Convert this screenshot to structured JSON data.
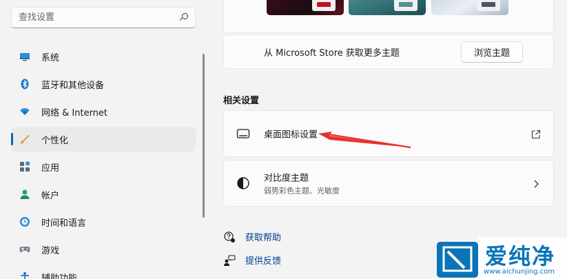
{
  "sidebar": {
    "search": {
      "placeholder": "查找设置"
    },
    "items": [
      {
        "label": "系统",
        "icon": "monitor-icon"
      },
      {
        "label": "蓝牙和其他设备",
        "icon": "bluetooth-icon"
      },
      {
        "label": "网络 & Internet",
        "icon": "wifi-icon"
      },
      {
        "label": "个性化",
        "icon": "brush-icon",
        "active": true
      },
      {
        "label": "应用",
        "icon": "apps-icon"
      },
      {
        "label": "帐户",
        "icon": "person-icon"
      },
      {
        "label": "时间和语言",
        "icon": "globe-clock-icon"
      },
      {
        "label": "游戏",
        "icon": "gamepad-icon"
      },
      {
        "label": "辅助功能",
        "icon": "accessibility-icon"
      }
    ]
  },
  "main": {
    "store": {
      "text": "从 Microsoft Store 获取更多主题",
      "button": "浏览主题"
    },
    "related_title": "相关设置",
    "cards": [
      {
        "title": "桌面图标设置",
        "subtitle": "",
        "action": "external-link-icon"
      },
      {
        "title": "对比度主题",
        "subtitle": "弱势彩色主题、光敏度",
        "action": "chevron-right-icon"
      }
    ],
    "links": [
      {
        "label": "获取帮助",
        "icon": "help-icon"
      },
      {
        "label": "提供反馈",
        "icon": "feedback-icon"
      }
    ]
  },
  "colors": {
    "accent": "#0067c0",
    "annotation_arrow": "#e8322f",
    "link": "#003e92",
    "watermark_bg": "#0a74b9"
  },
  "watermark": {
    "brand": "爱纯净",
    "url": "www.aichunjing.com"
  }
}
